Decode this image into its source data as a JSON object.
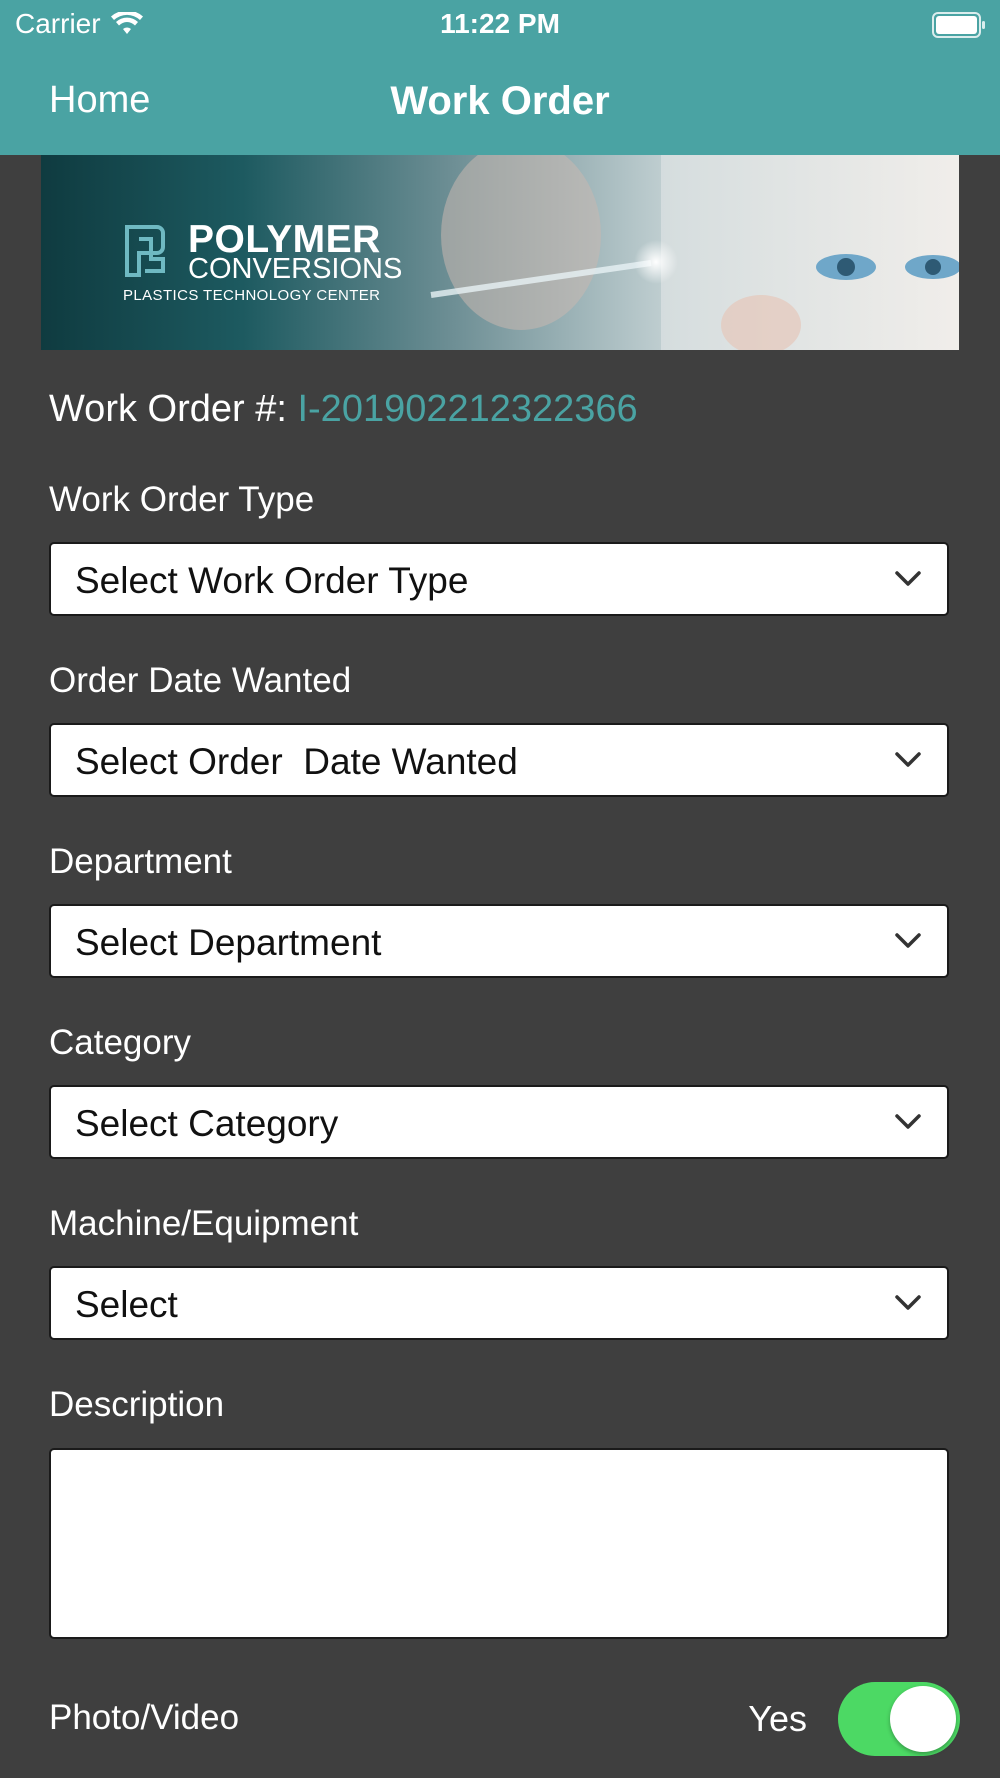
{
  "status_bar": {
    "carrier": "Carrier",
    "time": "11:22 PM",
    "icons": [
      "wifi-icon",
      "battery-icon"
    ]
  },
  "navbar": {
    "back_label": "Home",
    "title": "Work Order"
  },
  "banner": {
    "logo_line1": "POLYMER",
    "logo_line2": "CONVERSIONS",
    "logo_line3": "PLASTICS TECHNOLOGY CENTER"
  },
  "work_order": {
    "label": "Work Order #: ",
    "number": "I-201902212322366"
  },
  "fields": {
    "type": {
      "label": "Work Order Type",
      "placeholder": "Select Work Order Type"
    },
    "date": {
      "label": "Order  Date Wanted",
      "placeholder": "Select Order  Date Wanted"
    },
    "department": {
      "label": "Department",
      "placeholder": "Select Department"
    },
    "category": {
      "label": "Category",
      "placeholder": "Select Category"
    },
    "machine": {
      "label": "Machine/Equipment",
      "placeholder": "Select"
    },
    "description": {
      "label": "Description",
      "value": ""
    }
  },
  "photo_video": {
    "label": "Photo/Video",
    "toggle_text": "Yes",
    "toggle_on": true
  },
  "colors": {
    "accent": "#4aa3a3",
    "background": "#3f3f3f",
    "toggle_on": "#4cd964"
  }
}
